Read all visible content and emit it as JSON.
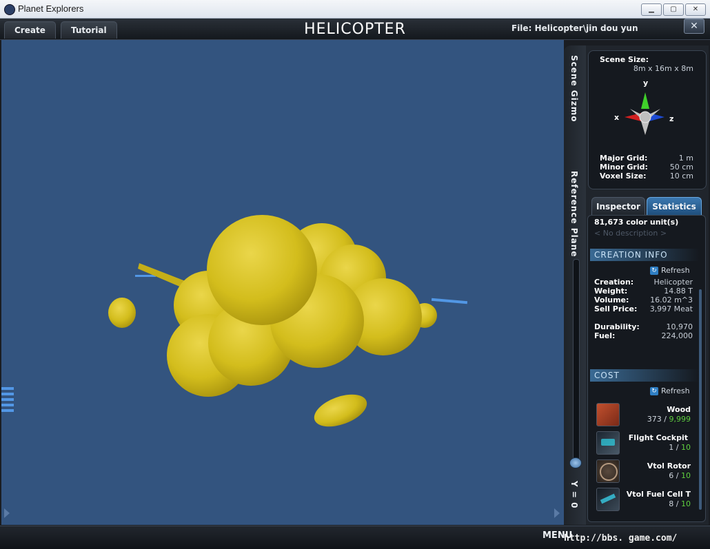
{
  "window": {
    "title": "Planet Explorers"
  },
  "topbar": {
    "tabs": [
      {
        "label": "Create"
      },
      {
        "label": "Tutorial"
      }
    ],
    "title": "HELICOPTER",
    "file_label": "File:",
    "file_path": "Helicopter\\jin dou yun",
    "close_label": "✕"
  },
  "side_tabs": {
    "scene_gizmo": "Scene Gizmo",
    "reference_plane": "Reference Plane",
    "y_value": "Y = 0"
  },
  "gizmo": {
    "scene_size_label": "Scene Size:",
    "scene_size_value": "8m x 16m x 8m",
    "axis_x": "x",
    "axis_y": "y",
    "axis_z": "z",
    "major_grid_label": "Major Grid:",
    "major_grid_value": "1 m",
    "minor_grid_label": "Minor Grid:",
    "minor_grid_value": "50 cm",
    "voxel_size_label": "Voxel Size:",
    "voxel_size_value": "10 cm"
  },
  "panel_tabs": {
    "inspector": "Inspector",
    "statistics": "Statistics"
  },
  "statistics": {
    "color_units": "81,673 color unit(s)",
    "description": "< No description >",
    "creation_info_header": "CREATION INFO",
    "refresh_label": "Refresh",
    "creation_label": "Creation:",
    "creation_value": "Helicopter",
    "weight_label": "Weight:",
    "weight_value": "14.88 T",
    "volume_label": "Volume:",
    "volume_value": "16.02 m^3",
    "sell_price_label": "Sell Price:",
    "sell_price_value": "3,997 Meat",
    "durability_label": "Durability:",
    "durability_value": "10,970",
    "fuel_label": "Fuel:",
    "fuel_value": "224,000",
    "cost_header": "COST",
    "cost_items": [
      {
        "name": "Wood",
        "have": "373",
        "sep": " / ",
        "max": "9,999",
        "icon": "wood-icon"
      },
      {
        "name": "Flight Cockpit",
        "have": "1",
        "sep": " / ",
        "max": "10",
        "icon": "flight-cockpit-icon"
      },
      {
        "name": "Vtol Rotor",
        "have": "6",
        "sep": " / ",
        "max": "10",
        "icon": "vtol-rotor-icon"
      },
      {
        "name": "Vtol Fuel Cell T",
        "have": "8",
        "sep": " / ",
        "max": "10",
        "icon": "vtol-fuel-cell-icon"
      }
    ]
  },
  "bottombar": {
    "menu_label": "MENU",
    "watermark": "http://bbs.  game.com/"
  },
  "colors": {
    "viewport_bg": "#33547f",
    "model_yellow": "#d8c21e",
    "accent_green": "#5fcf3f"
  }
}
